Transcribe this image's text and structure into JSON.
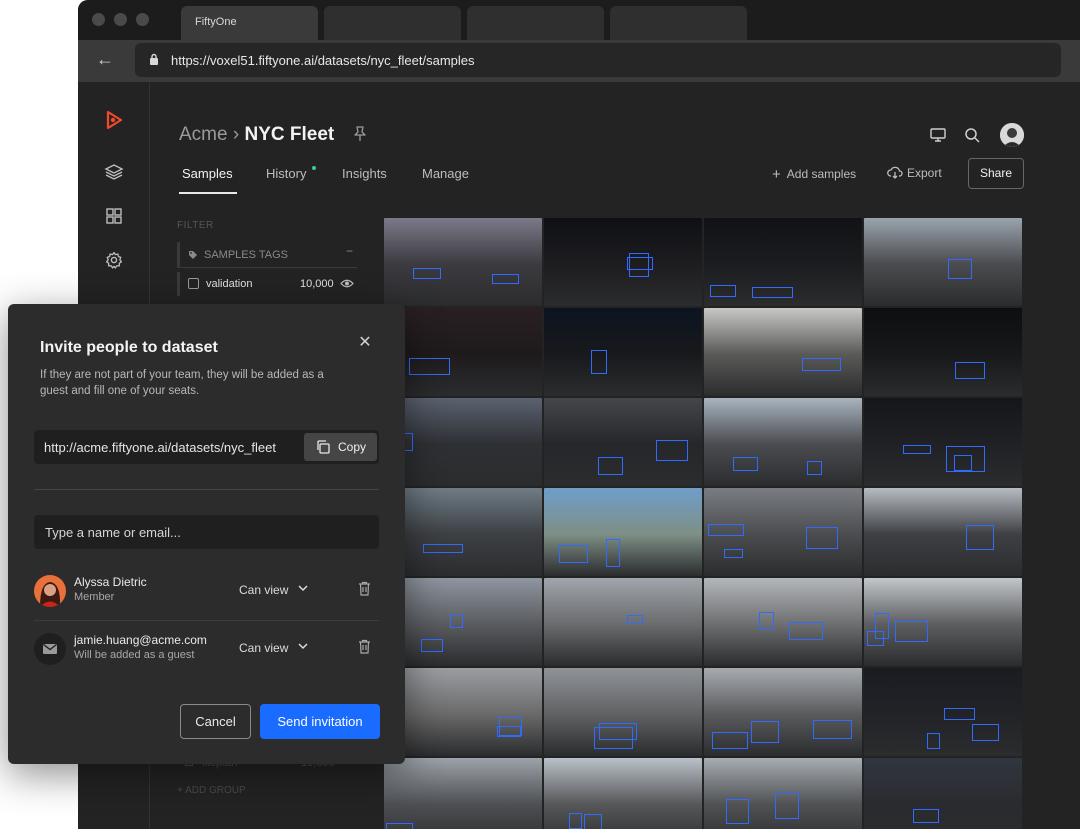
{
  "browser": {
    "active_tab": "FiftyOne",
    "url": "https://voxel51.fiftyone.ai/datasets/nyc_fleet/samples"
  },
  "header": {
    "org": "Acme",
    "separator": "›",
    "dataset": "NYC Fleet"
  },
  "tabs": [
    "Samples",
    "History",
    "Insights",
    "Manage"
  ],
  "actions": {
    "add_samples": "Add samples",
    "export": "Export",
    "share": "Share"
  },
  "sidebar": {
    "filter_label": "FILTER",
    "group_label": "SAMPLES TAGS",
    "group_collapse": "−",
    "tag_name": "validation",
    "tag_count": "10,000",
    "hidden_field": "filepath",
    "hidden_count": "10,000",
    "add_group": "+ ADD GROUP"
  },
  "modal": {
    "title": "Invite people to dataset",
    "subtitle": "If they are not part of your team, they will be added as a guest and fill one of your seats.",
    "link": "http://acme.fiftyone.ai/datasets/nyc_fleet",
    "copy": "Copy",
    "input_placeholder": "Type a name or email...",
    "people": [
      {
        "name": "Alyssa Dietric",
        "sub": "Member",
        "role": "Can view"
      },
      {
        "name": "jamie.huang@acme.com",
        "sub": "Will be added as a guest",
        "role": "Can view"
      }
    ],
    "cancel": "Cancel",
    "send": "Send invitation"
  },
  "colors": {
    "accent": "#1a6bff",
    "bbox": "#2f6bff",
    "history_dot": "#38c7a0",
    "logo": "#f04a2b"
  }
}
